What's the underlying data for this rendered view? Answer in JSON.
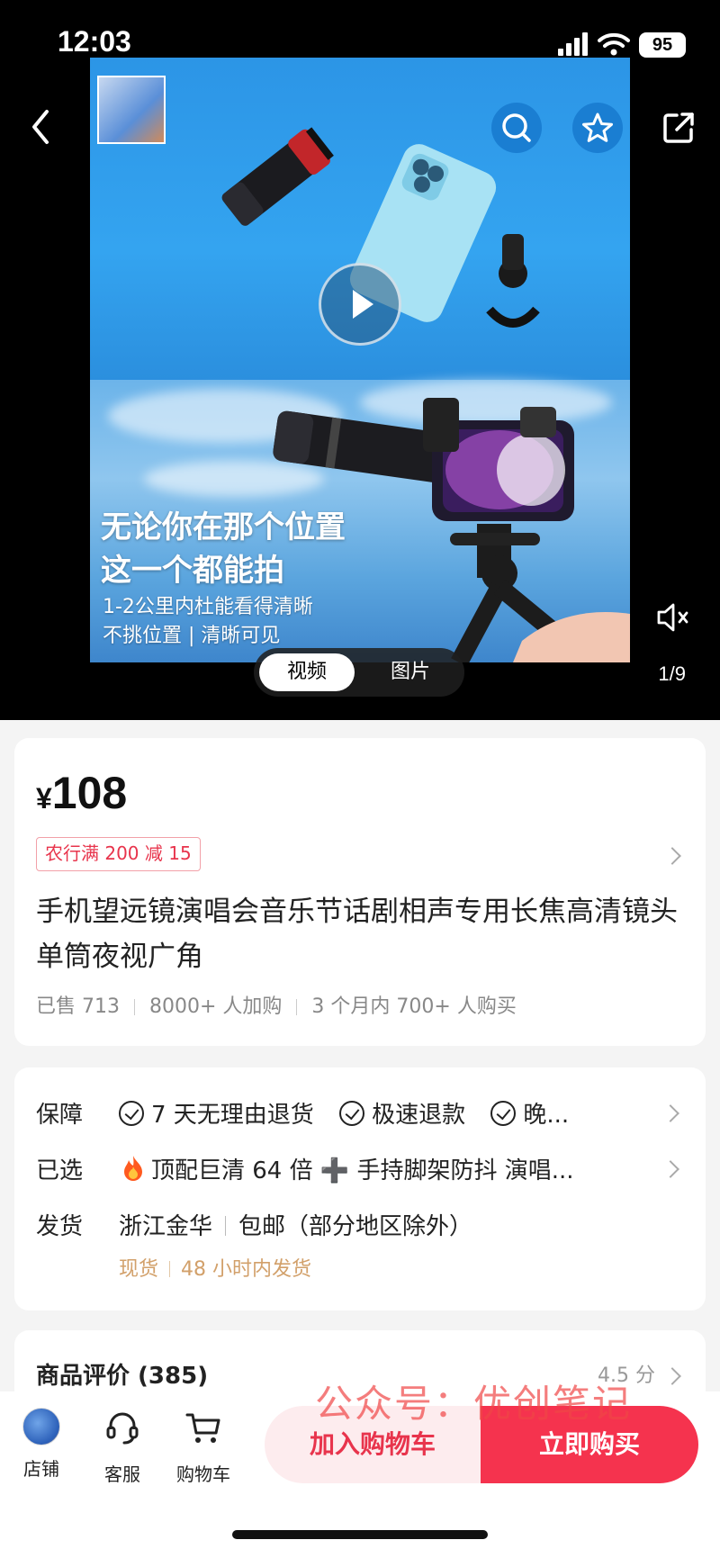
{
  "status_bar": {
    "time": "12:03",
    "battery": "95"
  },
  "media": {
    "promo_line1": "无论你在那个位置",
    "promo_line2": "这一个都能拍",
    "promo_line3": "1-2公里内杜能看得清晰",
    "promo_line4": "不挑位置 | 清晰可见",
    "tabs": [
      {
        "label": "视频",
        "selected": true
      },
      {
        "label": "图片",
        "selected": false
      }
    ],
    "page_counter": "1/9",
    "icons": [
      "back-icon",
      "search-icon",
      "star-icon",
      "share-icon",
      "play-icon",
      "mute-icon"
    ]
  },
  "product": {
    "currency": "¥",
    "price": "108",
    "coupon": "农行满 200 减 15",
    "title": "手机望远镜演唱会音乐节话剧相声专用长焦高清镜头单筒夜视广角",
    "sales": {
      "sold": "已售 713",
      "carts": "8000+ 人加购",
      "recent": "3 个月内 700+ 人购买"
    }
  },
  "info": {
    "guarantee": {
      "label": "保障",
      "items": [
        "7 天无理由退货",
        "极速退款",
        "晚..."
      ]
    },
    "selected": {
      "label": "已选",
      "value": "顶配巨清 64 倍 ➕ 手持脚架防抖 演唱..."
    },
    "shipping": {
      "label": "发货",
      "origin": "浙江金华",
      "fee": "包邮（部分地区除外）",
      "stock": "现货",
      "dispatch": "48 小时内发货"
    }
  },
  "reviews": {
    "title": "商品评价 (385)",
    "score": "4.5 分"
  },
  "bottom_bar": {
    "store": "店铺",
    "service": "客服",
    "cart": "购物车",
    "add_to_cart": "加入购物车",
    "buy_now": "立即购买"
  },
  "watermark": "公众号：优创笔记",
  "colors": {
    "accent": "#f5334e",
    "coupon": "#e8344c",
    "shipping_meta": "#d2a06a"
  }
}
